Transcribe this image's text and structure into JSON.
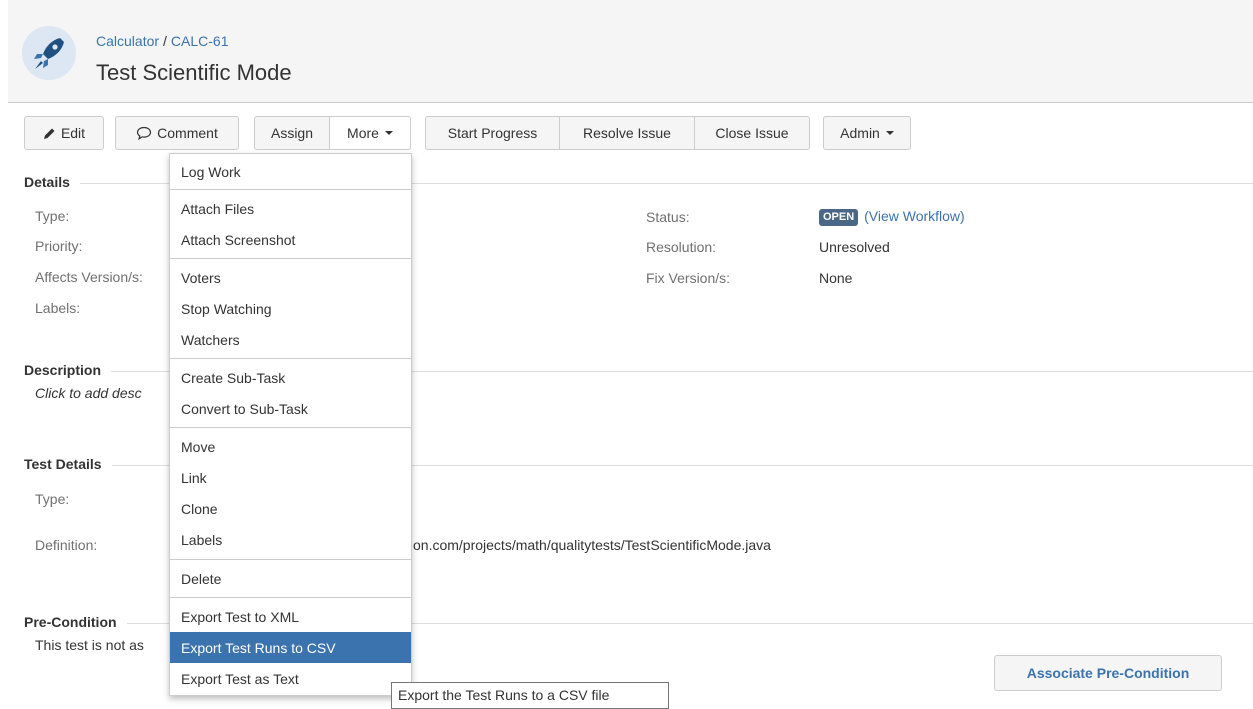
{
  "header": {
    "breadcrumb_project": "Calculator",
    "breadcrumb_sep": "/",
    "breadcrumb_issue": "CALC-61",
    "title": "Test Scientific Mode"
  },
  "toolbar": {
    "edit": "Edit",
    "comment": "Comment",
    "assign": "Assign",
    "more": "More",
    "start_progress": "Start Progress",
    "resolve_issue": "Resolve Issue",
    "close_issue": "Close Issue",
    "admin": "Admin"
  },
  "details": {
    "heading": "Details",
    "type_label": "Type:",
    "priority_label": "Priority:",
    "affects_label": "Affects Version/s:",
    "labels_label": "Labels:",
    "status_label": "Status:",
    "status_value": "OPEN",
    "view_workflow_open": "(",
    "view_workflow": "View Workflow",
    "view_workflow_close": ")",
    "resolution_label": "Resolution:",
    "resolution_value": "Unresolved",
    "fix_label": "Fix Version/s:",
    "fix_value": "None"
  },
  "description": {
    "heading": "Description",
    "placeholder_visible": "Click to add desc"
  },
  "test_details": {
    "heading": "Test Details",
    "type_label": "Type:",
    "definition_label": "Definition:",
    "definition_value_visible": "on.com/projects/math/qualitytests/TestScientificMode.java"
  },
  "precondition": {
    "heading": "Pre-Condition",
    "text_visible": "This test is not as",
    "associate_button": "Associate Pre-Condition"
  },
  "more_menu": {
    "items": [
      "Log Work",
      "Attach Files",
      "Attach Screenshot",
      "Voters",
      "Stop Watching",
      "Watchers",
      "Create Sub-Task",
      "Convert to Sub-Task",
      "Move",
      "Link",
      "Clone",
      "Labels",
      "Delete",
      "Export Test to XML",
      "Export Test Runs to CSV",
      "Export Test as Text"
    ],
    "highlighted_index": 14
  },
  "tooltip": {
    "text": "Export the Test Runs to a CSV file"
  },
  "colors": {
    "link": "#3b73af",
    "highlight": "#3b73af",
    "lozenge": "#4a6785",
    "header_bg": "#f5f5f5"
  },
  "icons": {
    "project": "rocket-icon",
    "edit": "pencil-icon",
    "comment": "speech-bubble-icon",
    "dropdown": "caret-down-icon"
  }
}
